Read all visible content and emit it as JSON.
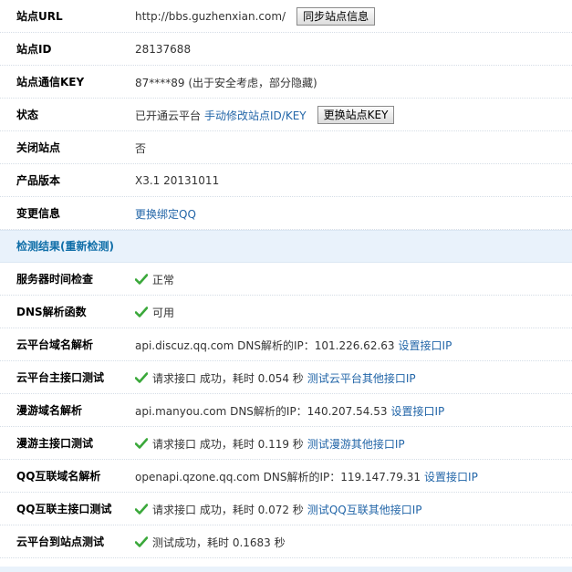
{
  "site": {
    "url_label": "站点URL",
    "url_value": "http://bbs.guzhenxian.com/",
    "sync_button": "同步站点信息",
    "id_label": "站点ID",
    "id_value": "28137688",
    "key_label": "站点通信KEY",
    "key_value": "87****89 (出于安全考虑，部分隐藏)",
    "status_label": "状态",
    "status_text": "已开通云平台",
    "status_link": "手动修改站点ID/KEY",
    "change_key_button": "更换站点KEY",
    "close_label": "关闭站点",
    "close_value": "否",
    "version_label": "产品版本",
    "version_value": "X3.1 20131011",
    "change_label": "变更信息",
    "change_link": "更换绑定QQ"
  },
  "check": {
    "title_prefix": "检测结果(",
    "recheck_link": "重新检测",
    "title_suffix": ")",
    "rows": [
      {
        "label": "服务器时间检查",
        "ok": true,
        "text": "正常",
        "link": ""
      },
      {
        "label": "DNS解析函数",
        "ok": true,
        "text": "可用",
        "link": ""
      },
      {
        "label": "云平台域名解析",
        "ok": false,
        "text": "api.discuz.qq.com DNS解析的IP：101.226.62.63",
        "link": "设置接口IP"
      },
      {
        "label": "云平台主接口测试",
        "ok": true,
        "text": "请求接口 成功，耗时 0.054 秒",
        "link": "测试云平台其他接口IP"
      },
      {
        "label": "漫游域名解析",
        "ok": false,
        "text": "api.manyou.com DNS解析的IP：140.207.54.53",
        "link": "设置接口IP"
      },
      {
        "label": "漫游主接口测试",
        "ok": true,
        "text": "请求接口 成功，耗时 0.119 秒",
        "link": "测试漫游其他接口IP"
      },
      {
        "label": "QQ互联域名解析",
        "ok": false,
        "text": "openapi.qzone.qq.com DNS解析的IP：119.147.79.31",
        "link": "设置接口IP"
      },
      {
        "label": "QQ互联主接口测试",
        "ok": true,
        "text": "请求接口 成功，耗时 0.072 秒",
        "link": "测试QQ互联其他接口IP"
      },
      {
        "label": "云平台到站点测试",
        "ok": true,
        "text": "测试成功，耗时 0.1683 秒",
        "link": ""
      }
    ]
  },
  "colors": {
    "link": "#2366a8",
    "section_bg": "#e9f2fb",
    "section_title": "#0f6ea8",
    "check_green": "#3aa83a"
  },
  "icons": {
    "ok": "check-icon"
  }
}
